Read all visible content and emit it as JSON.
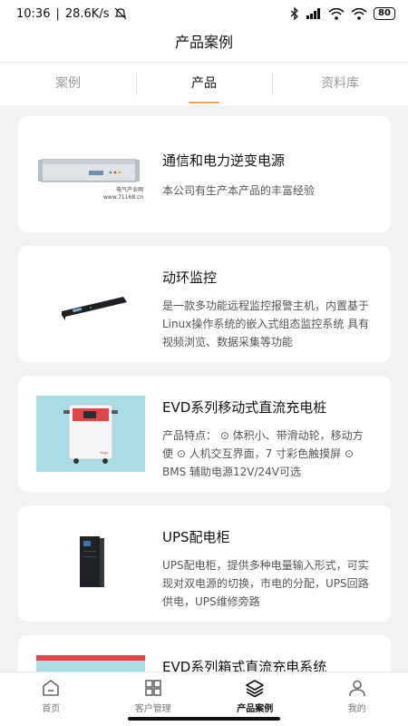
{
  "status_bar": {
    "time": "10:36",
    "network_speed": "28.6K/s",
    "battery": "80"
  },
  "header": {
    "title": "产品案例"
  },
  "tabs": [
    {
      "label": "案例",
      "active": false
    },
    {
      "label": "产品",
      "active": true
    },
    {
      "label": "资料库",
      "active": false
    }
  ],
  "products": [
    {
      "title": "通信和电力逆变电源",
      "desc": "本公司有生产本产品的丰富经验",
      "image": "rack-inverter",
      "image_caption": "电气产业网",
      "image_url_text": "www.71168.cn"
    },
    {
      "title": "动环监控",
      "desc": "是一款多功能远程监控报警主机，内置基于Linux操作系统的嵌入式组态监控系统 具有视频浏览、数据采集等功能",
      "image": "rack-monitor"
    },
    {
      "title": "EVD系列移动式直流充电桩",
      "desc": "产品特点： ⊙ 体积小、带滑动轮，移动方便 ⊙ 人机交互界面，7 寸彩色触摸屏 ⊙ BMS 辅助电源12V/24V可选",
      "image": "mobile-charger"
    },
    {
      "title": "UPS配电柜",
      "desc": "UPS配电柜，提供多种电量输入形式，可实现对双电源的切换，市电的分配，UPS回路供电，UPS维修旁路",
      "image": "ups-cabinet"
    },
    {
      "title": "EVD系列箱式直流充电系统",
      "desc": "",
      "image": "box-charger"
    }
  ],
  "bottom_nav": [
    {
      "label": "首页",
      "icon": "home-icon",
      "active": false
    },
    {
      "label": "客户管理",
      "icon": "grid-icon",
      "active": false
    },
    {
      "label": "产品案例",
      "icon": "layers-icon",
      "active": true
    },
    {
      "label": "我的",
      "icon": "user-icon",
      "active": false
    }
  ],
  "colors": {
    "accent": "#e8a25c",
    "background": "#f2f2f2"
  }
}
